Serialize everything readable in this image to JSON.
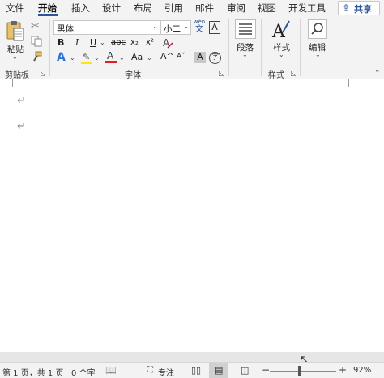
{
  "menu": {
    "tabs": [
      "文件",
      "开始",
      "插入",
      "设计",
      "布局",
      "引用",
      "邮件",
      "审阅",
      "视图",
      "开发工具"
    ],
    "active_tab": "开始",
    "share_label": "共享"
  },
  "ribbon": {
    "clipboard": {
      "paste_label": "粘贴",
      "group_label": "剪贴板"
    },
    "font": {
      "font_name": "黑体",
      "font_size": "小二",
      "phonetic_top": "wén",
      "phonetic_bottom": "文",
      "char_border": "A",
      "bold": "B",
      "italic": "I",
      "underline": "U",
      "strike": "abc",
      "subscript": "x₂",
      "superscript": "x²",
      "grow": "A^",
      "shrink": "Aˇ",
      "change_case": "Aa",
      "shading": "A",
      "enclose": "字",
      "group_label": "字体"
    },
    "paragraph": {
      "label": "段落"
    },
    "styles": {
      "label": "样式",
      "group_label": "样式"
    },
    "editing": {
      "label": "编辑"
    }
  },
  "document": {
    "paragraph_marks": [
      "↵",
      "↵"
    ]
  },
  "status": {
    "page": "第 1 页，共 1 页",
    "words": "0 个字",
    "focus": "专注",
    "zoom": "92%",
    "zoom_minus": "−",
    "zoom_plus": "+"
  },
  "colors": {
    "accent": "#2b579a",
    "highlight": "#ffe600",
    "font_color": "#e02020",
    "text_effect": "#2e75d6"
  },
  "icons": [
    "cut-icon",
    "copy-icon",
    "format-painter-icon",
    "paste-icon",
    "clear-format-icon",
    "paragraph-icon",
    "styles-icon",
    "search-icon",
    "read-mode-icon",
    "print-layout-icon",
    "web-layout-icon",
    "focus-icon",
    "proofing-icon"
  ]
}
